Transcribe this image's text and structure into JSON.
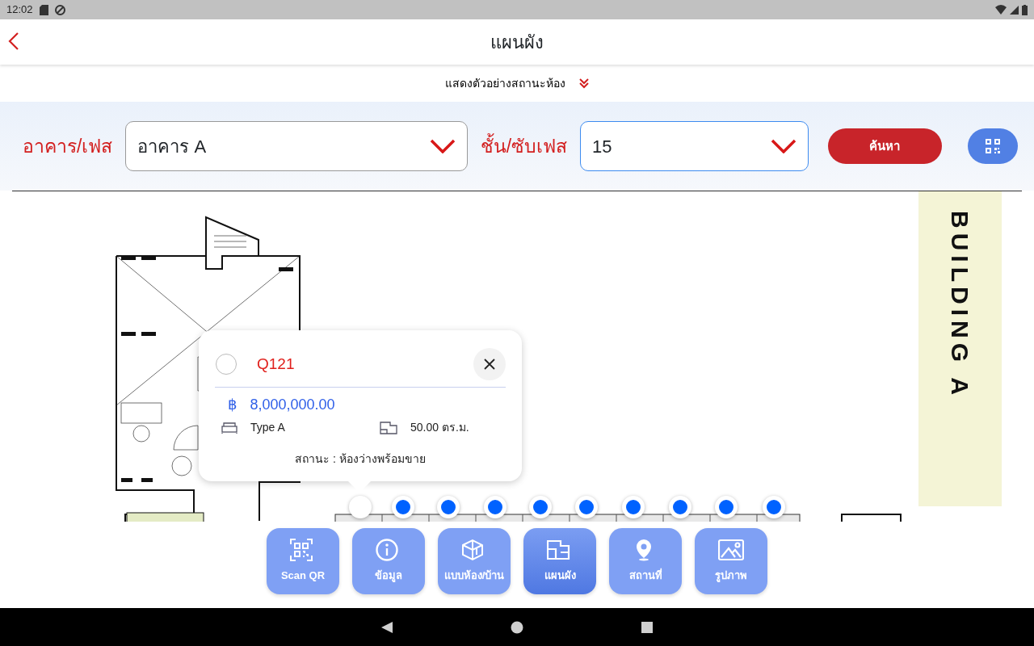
{
  "status_bar": {
    "time": "12:02"
  },
  "header": {
    "title": "แผนผัง"
  },
  "legend_toggle": {
    "label": "แสดงตัวอย่างสถานะห้อง",
    "expanded": false
  },
  "filters": [
    {
      "label": "อาคาร/เฟส",
      "value": "อาคาร A",
      "focused": false
    },
    {
      "label": "ชั้น/ซับเฟส",
      "value": "15",
      "focused": true
    }
  ],
  "search_button": "ค้นหา",
  "plan": {
    "building_label": "BUILDING A",
    "units": [
      {
        "selected": true
      },
      {
        "selected": false
      },
      {
        "selected": false
      },
      {
        "selected": false
      },
      {
        "selected": false
      },
      {
        "selected": false
      },
      {
        "selected": false
      },
      {
        "selected": false
      },
      {
        "selected": false
      },
      {
        "selected": false
      }
    ]
  },
  "popup": {
    "unit": "Q121",
    "price_symbol": "฿",
    "price": "8,000,000.00",
    "type": "Type A",
    "area": "50.00 ตร.ม.",
    "status": "สถานะ : ห้องว่างพร้อมขาย"
  },
  "tabs": [
    {
      "label": "Scan QR",
      "selected": false
    },
    {
      "label": "ข้อมูล",
      "selected": false
    },
    {
      "label": "แบบห้อง/บ้าน",
      "selected": false
    },
    {
      "label": "แผนผัง",
      "selected": true
    },
    {
      "label": "สถานที่",
      "selected": false
    },
    {
      "label": "รูปภาพ",
      "selected": false
    }
  ]
}
